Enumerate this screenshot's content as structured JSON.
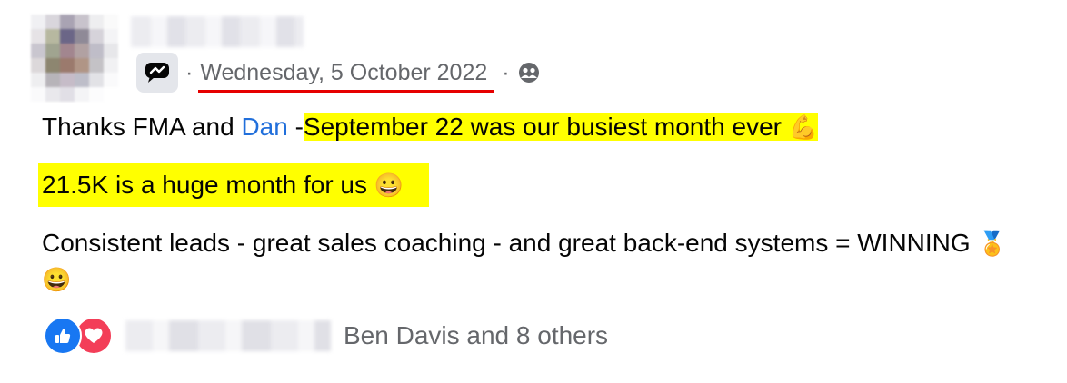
{
  "post": {
    "date": "Wednesday, 5 October 2022",
    "separator": "·",
    "lines": {
      "l1_prefix": "Thanks FMA and ",
      "l1_mention": "Dan",
      "l1_dash": " -",
      "l1_highlight": "September 22 was our busiest month ever ",
      "l1_emoji": "💪",
      "l2_highlight": "21.5K is a huge month for us ",
      "l2_emoji": "😀",
      "l3_text": "Consistent leads - great sales coaching - and great back-end systems = WINNING ",
      "l3_emoji_medal": "🏅",
      "l3_emoji_grin": "😀"
    }
  },
  "reactions": {
    "summary": "Ben Davis and 8 others",
    "types": [
      "like",
      "love"
    ]
  },
  "icons": {
    "group_badge": "group-chat-icon",
    "audience": "members-audience-icon",
    "like": "thumbs-up-icon",
    "love": "heart-icon"
  },
  "colors": {
    "highlight": "#ffff00",
    "mention": "#216fdb",
    "meta": "#65676b",
    "underline_annotation": "#e60000",
    "like": "#1877f2",
    "love": "#f33e58"
  }
}
